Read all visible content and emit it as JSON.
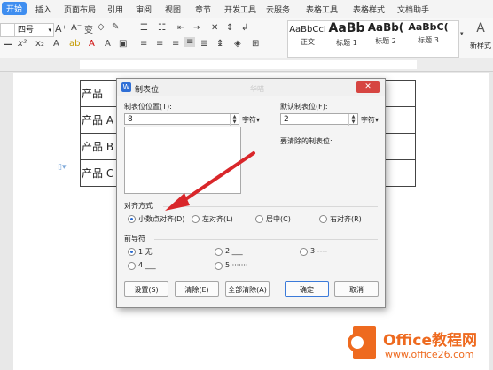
{
  "tabs": [
    "开始",
    "插入",
    "页面布局",
    "引用",
    "审阅",
    "视图",
    "章节",
    "开发工具",
    "云服务",
    "表格工具",
    "表格样式",
    "文档助手"
  ],
  "ribbon": {
    "font_size": "四号",
    "styles": [
      {
        "sample": "AaBbCcI",
        "name": "正文"
      },
      {
        "sample": "AaBb",
        "name": "标题 1"
      },
      {
        "sample": "AaBb(",
        "name": "标题 2"
      },
      {
        "sample": "AaBbC(",
        "name": "标题 3"
      }
    ],
    "new_style_label": "新样式"
  },
  "document": {
    "rows": [
      "产品",
      "产品 A",
      "产品 B",
      "产品 C"
    ]
  },
  "dialog": {
    "title": "制表位",
    "tab_position_label": "制表位位置(T):",
    "tab_position_value": "8",
    "tab_position_unit": "字符",
    "default_label": "默认制表位(F):",
    "default_value": "2",
    "default_unit": "字符",
    "clear_label": "要清除的制表位:",
    "background_text": "华喵",
    "alignment_title": "对齐方式",
    "alignment": [
      {
        "label": "小数点对齐(D)",
        "checked": true
      },
      {
        "label": "左对齐(L)",
        "checked": false
      },
      {
        "label": "居中(C)",
        "checked": false
      },
      {
        "label": "右对齐(R)",
        "checked": false
      }
    ],
    "leader_title": "前导符",
    "leaders": [
      {
        "label": "1 无",
        "checked": true
      },
      {
        "label": "2 ___",
        "checked": false
      },
      {
        "label": "3 ----",
        "checked": false
      },
      {
        "label": "4 ___",
        "checked": false
      },
      {
        "label": "5 ·······",
        "checked": false
      }
    ],
    "buttons": {
      "set": "设置(S)",
      "clear": "清除(E)",
      "clear_all": "全部清除(A)",
      "ok": "确定",
      "cancel": "取消"
    }
  },
  "watermark": {
    "brand": "Office教程网",
    "url": "www.office26.com"
  },
  "colors": {
    "accent": "#3f8ef0",
    "arrow": "#d9262a",
    "logo_orange": "#ee6a1f"
  }
}
